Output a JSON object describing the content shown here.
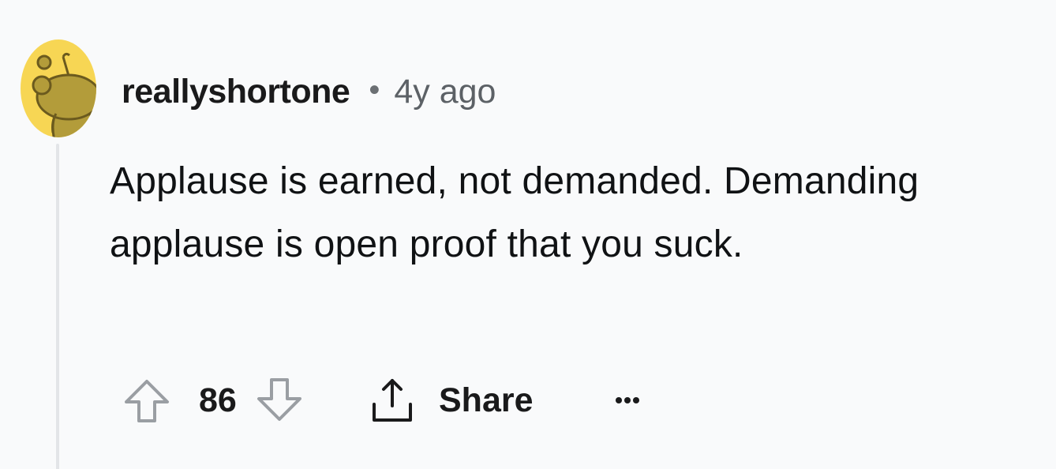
{
  "comment": {
    "author": "reallyshortone",
    "separator": "•",
    "age": "4y ago",
    "body": "Applause is earned, not demanded. Demanding applause is open proof that you suck.",
    "score": "86",
    "share_label": "Share"
  },
  "icons": {
    "avatar": "reddit-snoo-avatar",
    "upvote": "arrow-up-icon",
    "downvote": "arrow-down-icon",
    "share": "share-icon",
    "more": "more-options-icon"
  },
  "colors": {
    "avatar_bg": "#f7d654",
    "avatar_figure": "#b39c3a",
    "text_primary": "#1a1a1b",
    "text_secondary": "#5c6166",
    "background": "#f9fafb",
    "thread_line": "#e3e5e8"
  }
}
